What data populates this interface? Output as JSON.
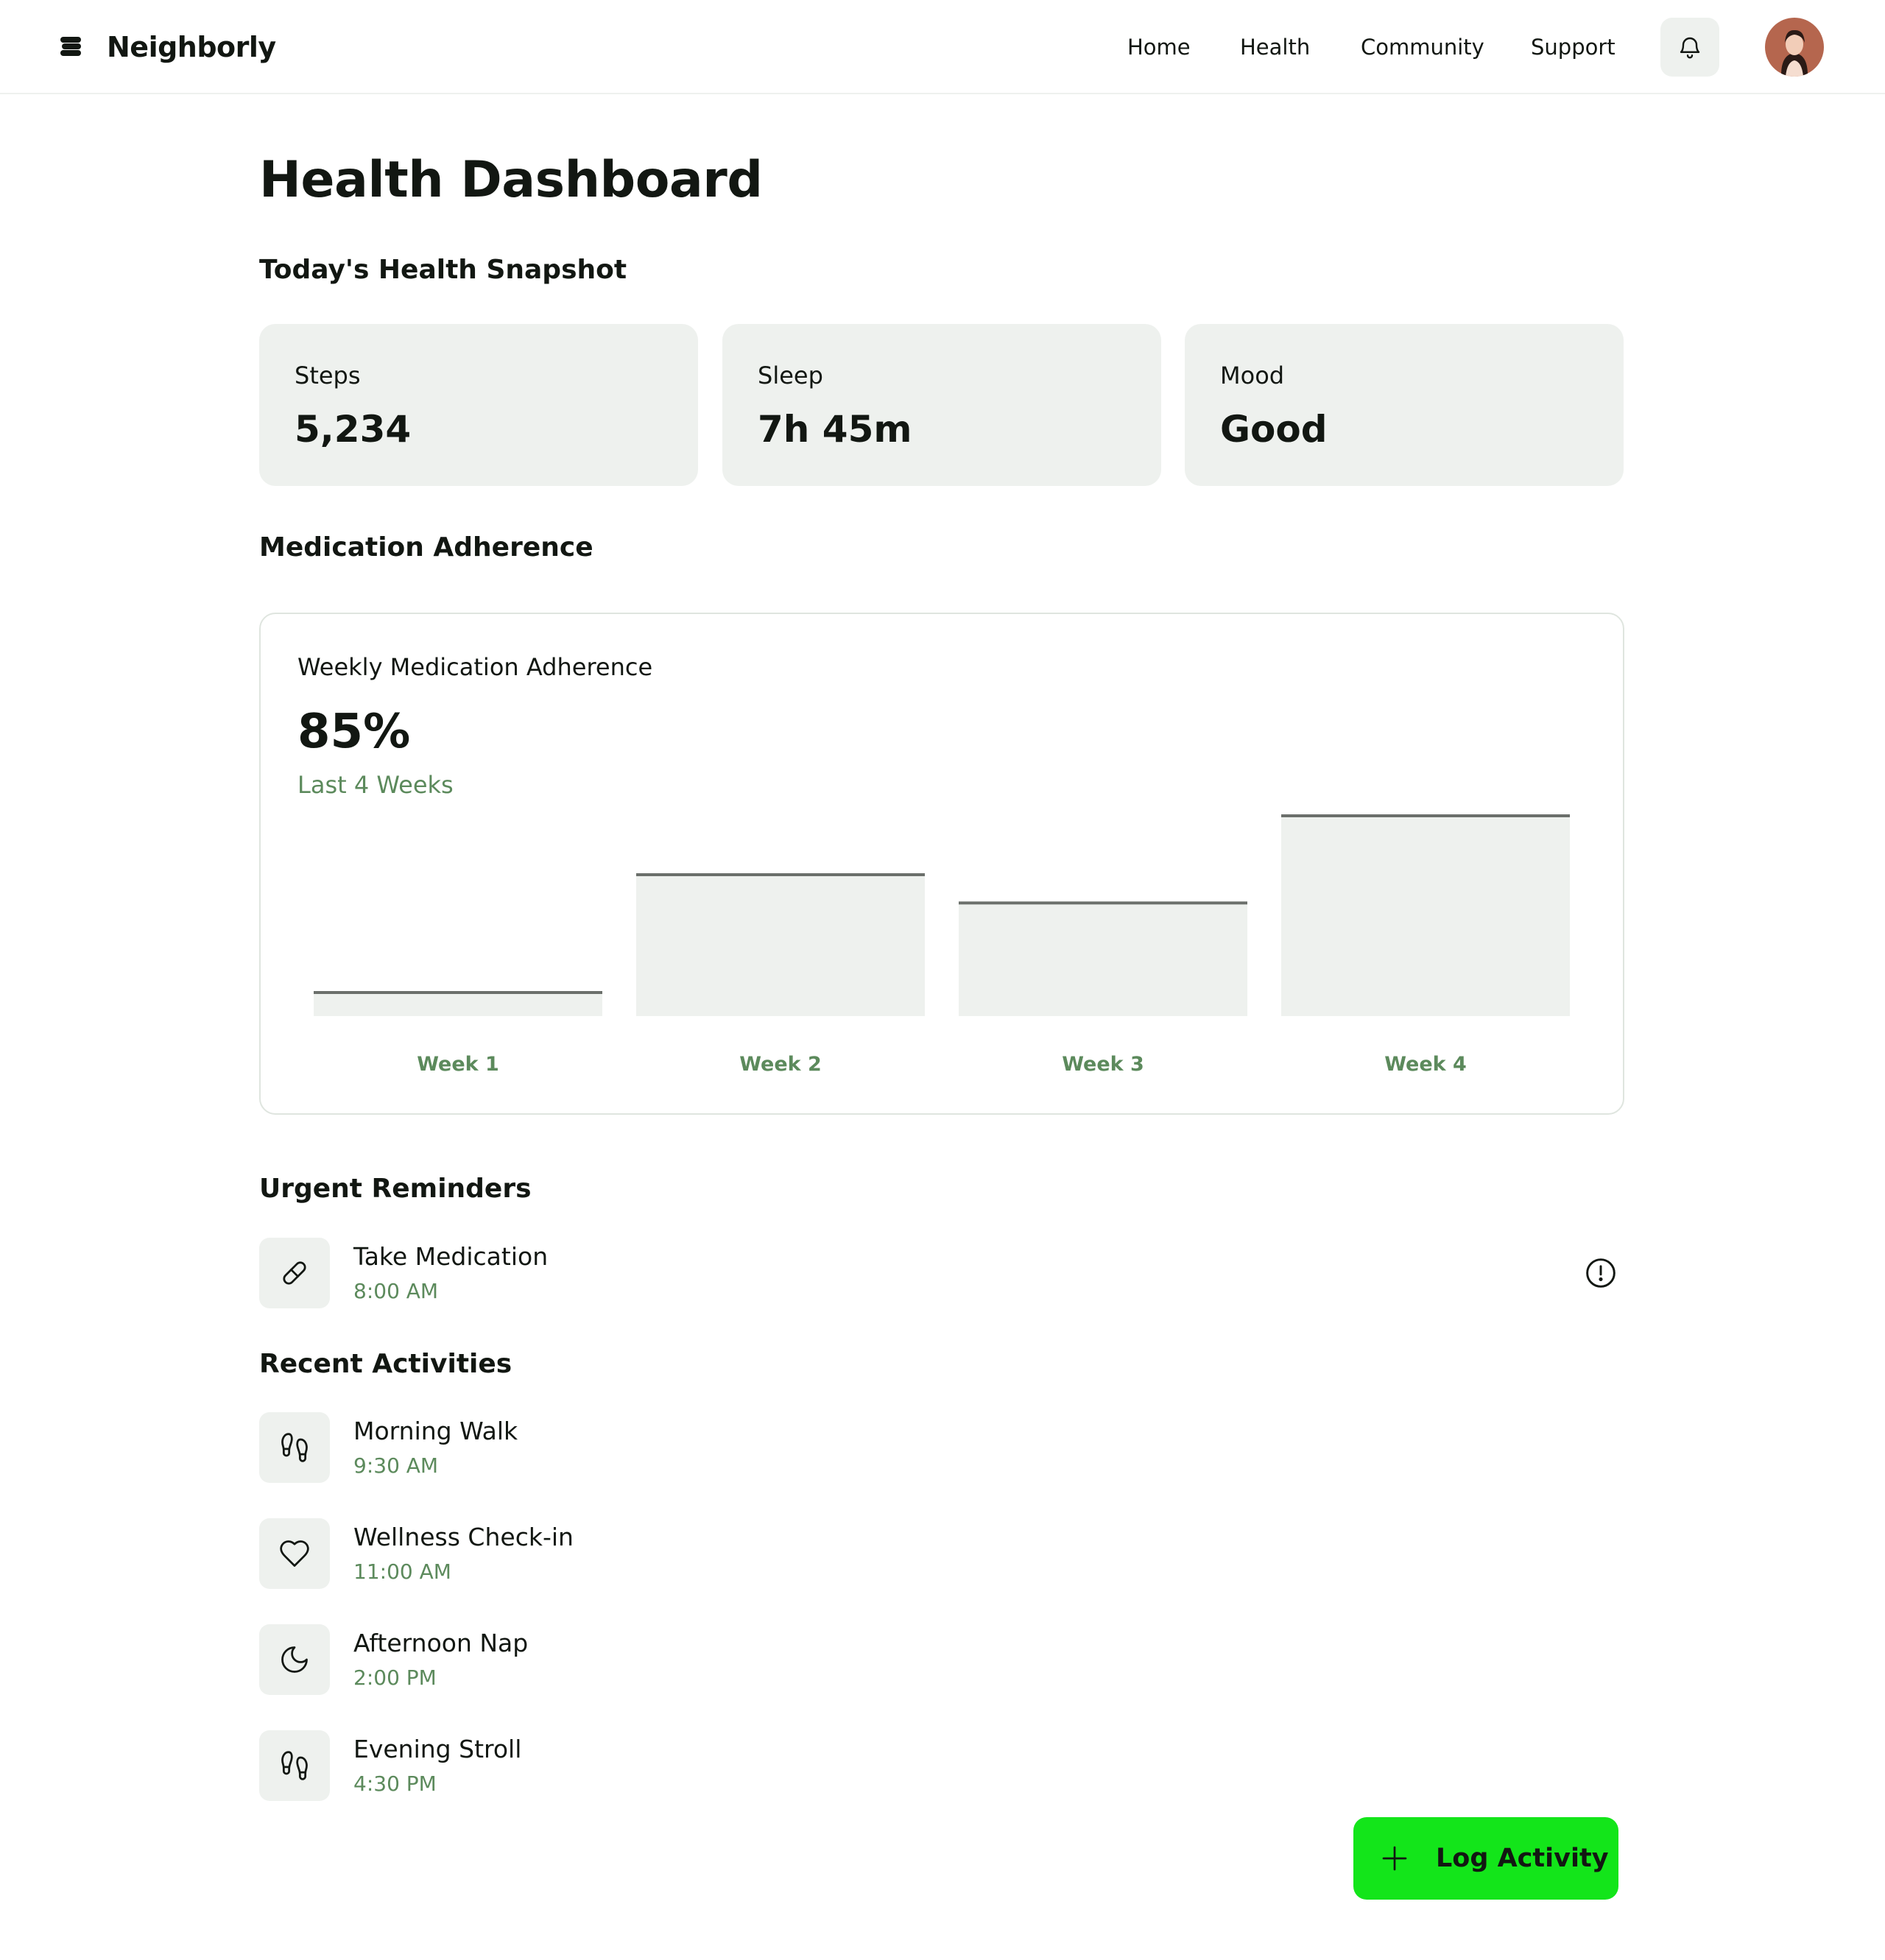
{
  "header": {
    "brand": "Neighborly",
    "nav": [
      "Home",
      "Health",
      "Community",
      "Support"
    ]
  },
  "page": {
    "title": "Health Dashboard",
    "snapshot_title": "Today's Health Snapshot",
    "stats": [
      {
        "label": "Steps",
        "value": "5,234"
      },
      {
        "label": "Sleep",
        "value": "7h 45m"
      },
      {
        "label": "Mood",
        "value": "Good"
      }
    ],
    "medication_title": "Medication Adherence",
    "urgent_title": "Urgent Reminders",
    "recent_title": "Recent Activities"
  },
  "chart_data": {
    "type": "bar",
    "title": "Weekly Medication Adherence",
    "headline": "85%",
    "subtitle": "Last 4 Weeks",
    "categories": [
      "Week 1",
      "Week 2",
      "Week 3",
      "Week 4"
    ],
    "values": [
      10,
      60,
      48,
      85
    ],
    "ylim": [
      0,
      100
    ]
  },
  "reminders": [
    {
      "title": "Take Medication",
      "time": "8:00 AM",
      "icon": "pill-icon"
    }
  ],
  "activities": [
    {
      "title": "Morning Walk",
      "time": "9:30 AM",
      "icon": "footprints-icon"
    },
    {
      "title": "Wellness Check-in",
      "time": "11:00 AM",
      "icon": "heart-icon"
    },
    {
      "title": "Afternoon Nap",
      "time": "2:00 PM",
      "icon": "moon-icon"
    },
    {
      "title": "Evening Stroll",
      "time": "4:30 PM",
      "icon": "footprints-icon"
    }
  ],
  "fab": {
    "label": "Log Activity"
  },
  "colors": {
    "accent_green": "#13e51a",
    "muted_green": "#5c8a5c",
    "card_bg": "#eef1ee",
    "text": "#121712"
  }
}
